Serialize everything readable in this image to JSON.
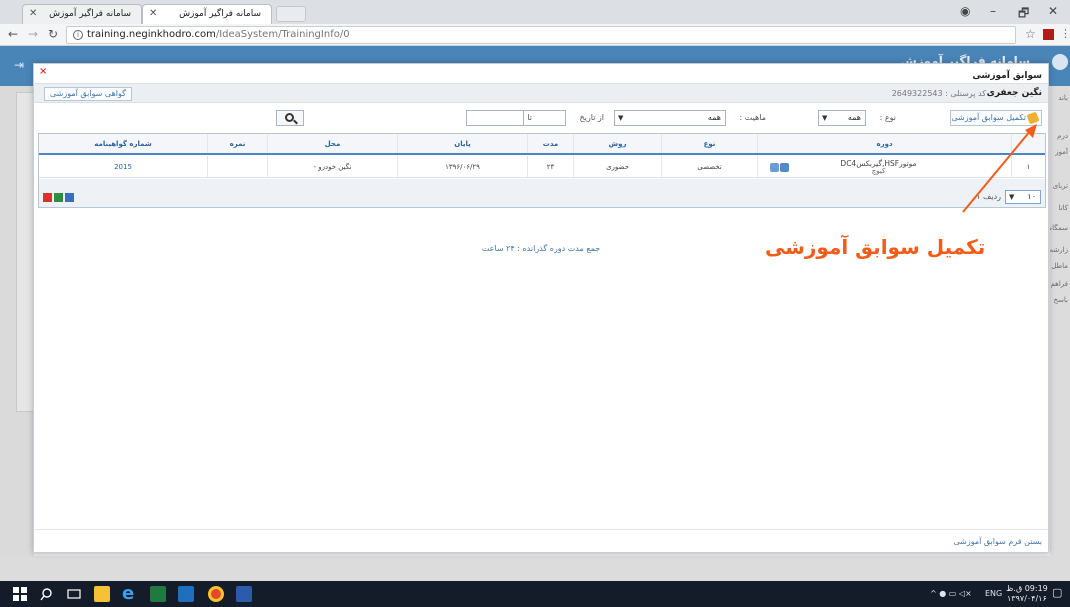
{
  "browser": {
    "tabs": [
      {
        "title": "سامانه فراگیر آموزش",
        "active": false
      },
      {
        "title": "سامانه فراگیر آموزش",
        "active": true
      }
    ],
    "url_host": "training.neginkhodro.com",
    "url_path": "/IdeaSystem/TrainingInfo/0",
    "window_controls": {
      "minimize": "–",
      "restore": "🗗",
      "close": "✕"
    }
  },
  "page": {
    "title": "سامانه فراگیر آموزش",
    "side_texts": [
      "باند",
      "درم",
      "آموز",
      "تربای",
      "کاتا",
      "سمگاه",
      "زارشه",
      "ماطل",
      "فراهم",
      "باسخ"
    ]
  },
  "modal": {
    "title": "سوابق آموزشی",
    "close_glyph": "×",
    "employee_name": "نگین جعفری",
    "employee_code_label": "کد پرسنلی : 2649322543",
    "certificate_button": "گواهی سوابق آموزشی",
    "complete_button": "تکمیل سوابق آموزشی",
    "filters": {
      "type_label": "نوع :",
      "type_value": "همه",
      "nature_label": "ماهیت :",
      "nature_value": "همه",
      "from_label": "از تاریخ",
      "to_label": "تا",
      "from_value": "",
      "to_value": ""
    },
    "table": {
      "headers": [
        "دوره",
        "نوع",
        "روش",
        "مدت",
        "پایان",
        "محل",
        "نمره",
        "شماره گواهینامه"
      ],
      "rows": [
        {
          "index": "۱",
          "course": "موتورHSF,گیربکسDC4",
          "course_sub": "کیوچ",
          "type": "تخصصی",
          "method": "حضوری",
          "duration": "۲۴",
          "end": "۱۳۹۶/۰۶/۲۹",
          "location": "نگین خودرو -",
          "score": "",
          "certificate_no": "2015"
        }
      ]
    },
    "pager": {
      "page_size": "۱۰",
      "label": "ردیف ۱"
    },
    "total_hours": "جمع مدت دوره گذرانده : ۲۴ ساعت",
    "close_form_link": "بستن فرم سوابق آموزشی"
  },
  "annotation": {
    "text": "تکمیل سوابق آموزشی",
    "color": "#f25c19"
  },
  "taskbar": {
    "language": "ENG",
    "time": "09:19 ق.ظ",
    "date": "۱۳۹۷/۰۴/۱۶"
  },
  "colors": {
    "accent": "#4a85b8",
    "link": "#4377a8",
    "header_text": "#2a62a4"
  }
}
